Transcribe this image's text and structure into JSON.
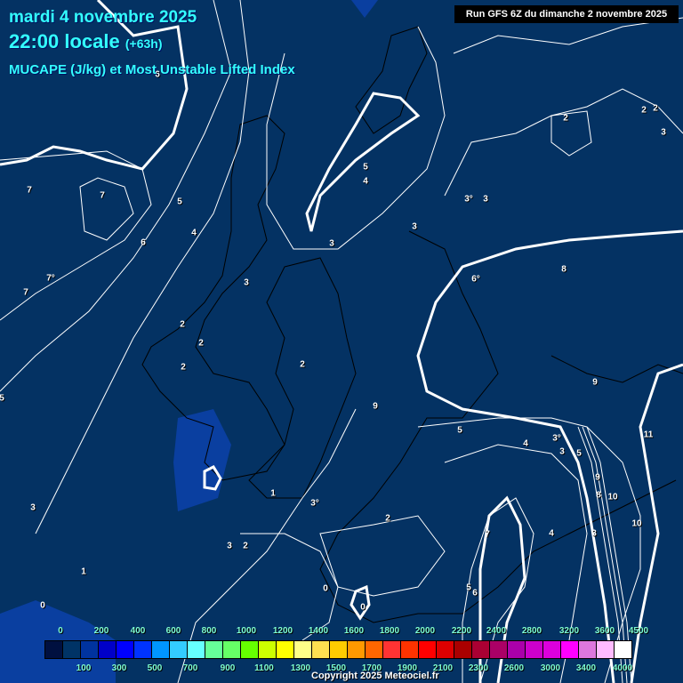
{
  "header": {
    "date": "mardi 4 novembre 2025",
    "time": "22:00 locale",
    "lead": "(+63h)",
    "parameter": "MUCAPE (J/kg) et Most Unstable Lifted Index",
    "run": "Run GFS 6Z du dimanche 2 novembre 2025"
  },
  "colors": {
    "background": "#043263",
    "cape_low": "#0a3fa0"
  },
  "contour_labels": [
    "6",
    "7",
    "7",
    "7",
    "7°",
    "5",
    "4",
    "6",
    "3",
    "2",
    "2",
    "2",
    "2",
    "3",
    "5",
    "4",
    "3",
    "3°",
    "3",
    "2",
    "2",
    "2",
    "3",
    "8",
    "6°",
    "9",
    "11",
    "5",
    "4",
    "3°",
    "3",
    "5",
    "9",
    "8",
    "10",
    "10",
    "1",
    "3°",
    "2",
    "3",
    "2",
    "7",
    "4",
    "3",
    "5",
    "6",
    "0",
    "0",
    "1",
    "0",
    "3",
    "5",
    "9"
  ],
  "legend": {
    "top_ticks": [
      "0",
      "200",
      "400",
      "600",
      "800",
      "1000",
      "1200",
      "1400",
      "1600",
      "1800",
      "2000",
      "2200",
      "2400",
      "2800",
      "3200",
      "3600",
      "4500"
    ],
    "bottom_ticks": [
      "100",
      "300",
      "500",
      "700",
      "900",
      "1100",
      "1300",
      "1500",
      "1700",
      "1900",
      "2100",
      "2300",
      "2600",
      "3000",
      "3400",
      "4000"
    ],
    "swatches": [
      "#001040",
      "#003366",
      "#00339f",
      "#0000c8",
      "#0000ff",
      "#0033ff",
      "#0096ff",
      "#33ccff",
      "#66ffff",
      "#66ff99",
      "#66ff66",
      "#66ff00",
      "#ccff00",
      "#ffff00",
      "#ffff88",
      "#ffe050",
      "#ffcc00",
      "#ff9900",
      "#ff6600",
      "#ff3333",
      "#ff3300",
      "#ff0000",
      "#dd0000",
      "#aa0000",
      "#aa0033",
      "#aa0066",
      "#aa00aa",
      "#cc00cc",
      "#dd00dd",
      "#ff00ff",
      "#dd77dd",
      "#ffbbff",
      "#ffffff"
    ]
  },
  "copyright": "Copyright 2025 Meteociel.fr"
}
